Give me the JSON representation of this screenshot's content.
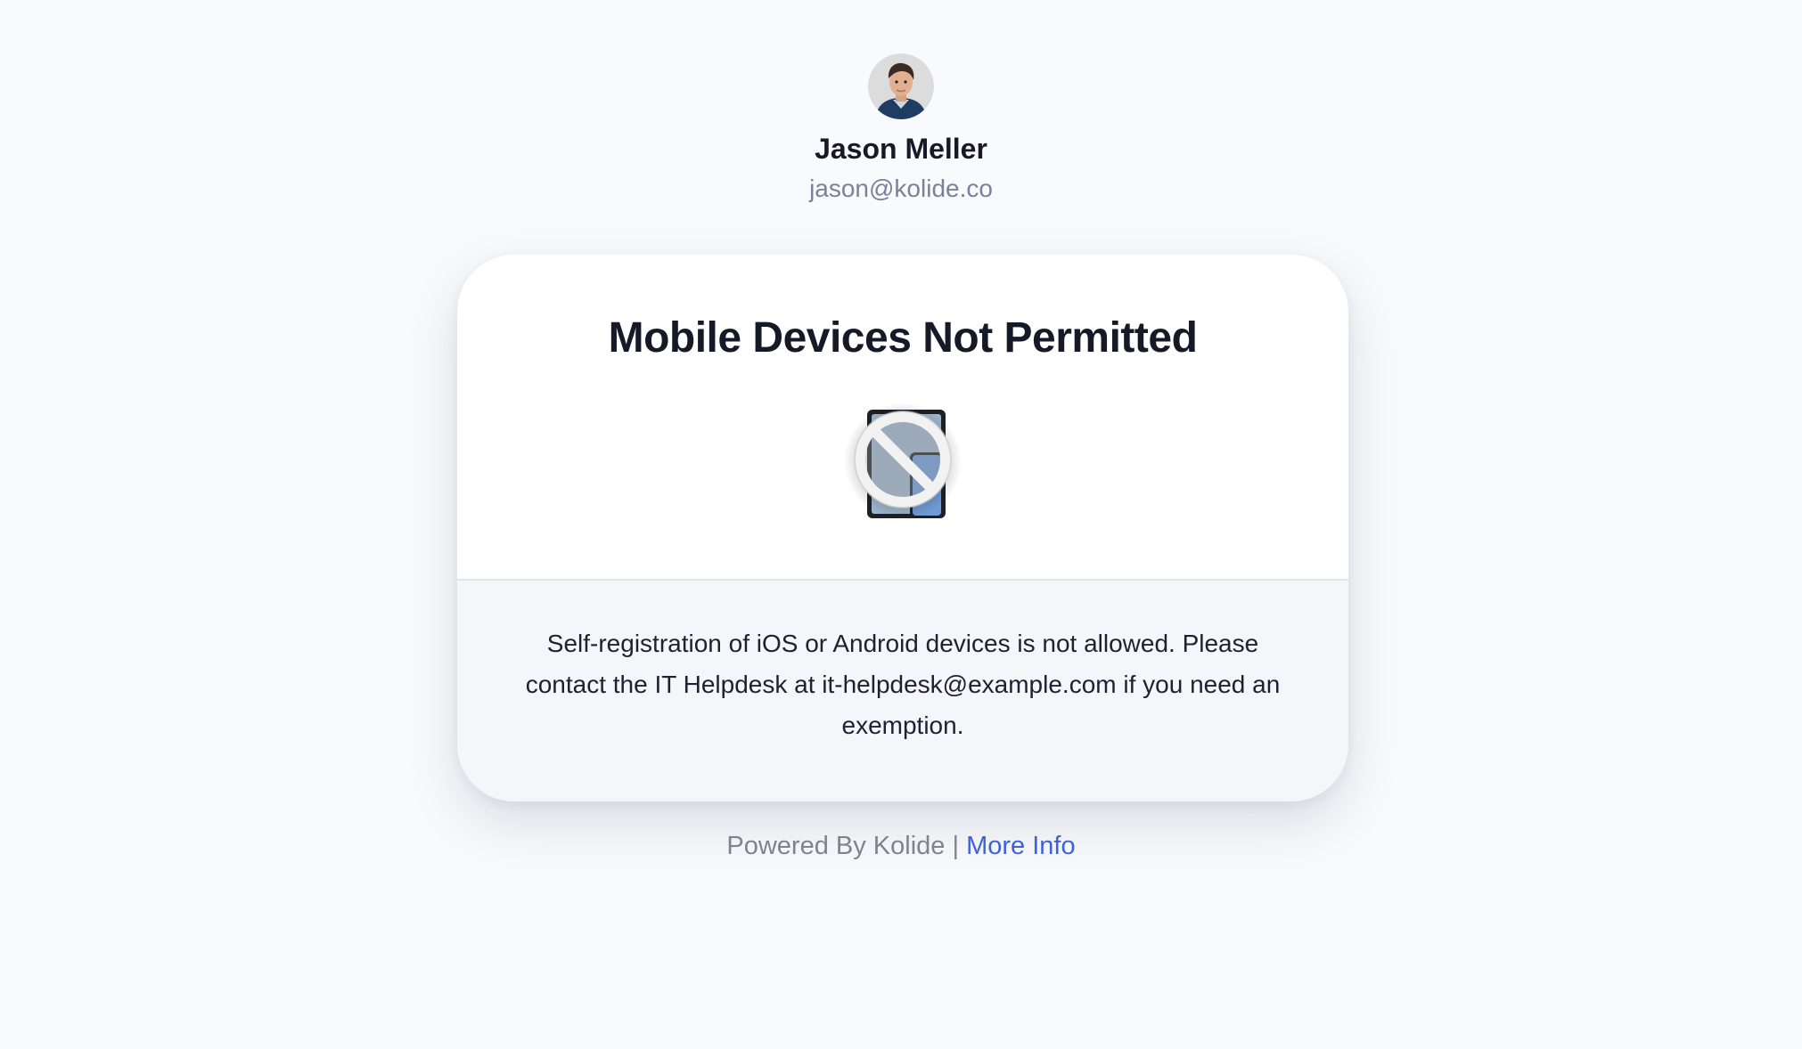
{
  "user": {
    "name": "Jason Meller",
    "email": "jason@kolide.co",
    "avatar_alt": "avatar"
  },
  "card": {
    "title": "Mobile Devices Not Permitted",
    "graphic_icon": "mobile-devices-prohibited-icon",
    "message": "Self-registration of iOS or Android devices is not allowed. Please contact the IT Helpdesk at it-helpdesk@example.com if you need an exemption."
  },
  "footer": {
    "powered_by": "Powered By Kolide",
    "separator": "|",
    "more_info_label": "More Info"
  },
  "colors": {
    "background": "#f9fafd",
    "card": "#ffffff",
    "card_body": "#f5f6f9",
    "link": "#3f63d6",
    "muted_text": "#80838c",
    "email_text": "#7a8299"
  }
}
